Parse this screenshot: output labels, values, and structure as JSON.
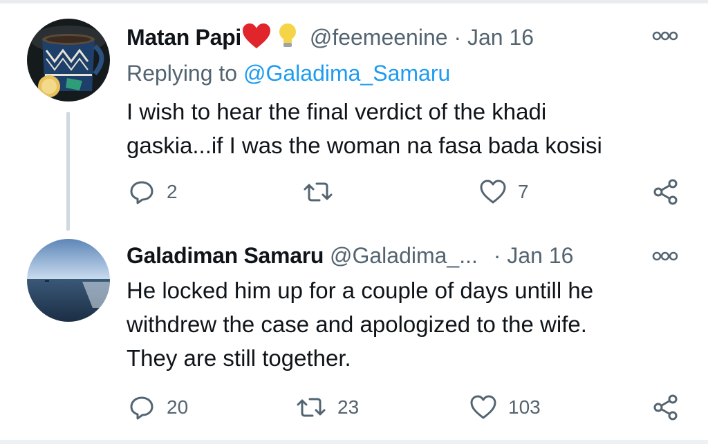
{
  "tweets": [
    {
      "name": "Matan Papi",
      "handle": "@feemeenine",
      "separator": "·",
      "date": "Jan 16",
      "replying_prefix": "Replying to",
      "replying_to": "@Galadima_Samaru",
      "text_lines": [
        "I wish to hear the final verdict of the khadi",
        "gaskia...if I was the woman na fasa bada kosisi"
      ],
      "reply_count": "2",
      "retweet_count": "",
      "like_count": "7",
      "emojis": [
        "red-heart",
        "light-bulb"
      ]
    },
    {
      "name": "Galadiman Samaru",
      "handle": "@Galadima_...",
      "separator": "·",
      "date": "Jan 16",
      "text_lines": [
        "He locked him up for a couple of days untill he",
        "withdrew the case and apologized to the wife.",
        "They are still together."
      ],
      "reply_count": "20",
      "retweet_count": "23",
      "like_count": "103"
    }
  ],
  "colors": {
    "text_primary": "#0f1419",
    "text_secondary": "#536471",
    "link": "#1d9bf0",
    "thread_line": "#cfd9de"
  },
  "icons": [
    "reply-icon",
    "retweet-icon",
    "like-icon",
    "share-icon",
    "more-options-icon"
  ]
}
